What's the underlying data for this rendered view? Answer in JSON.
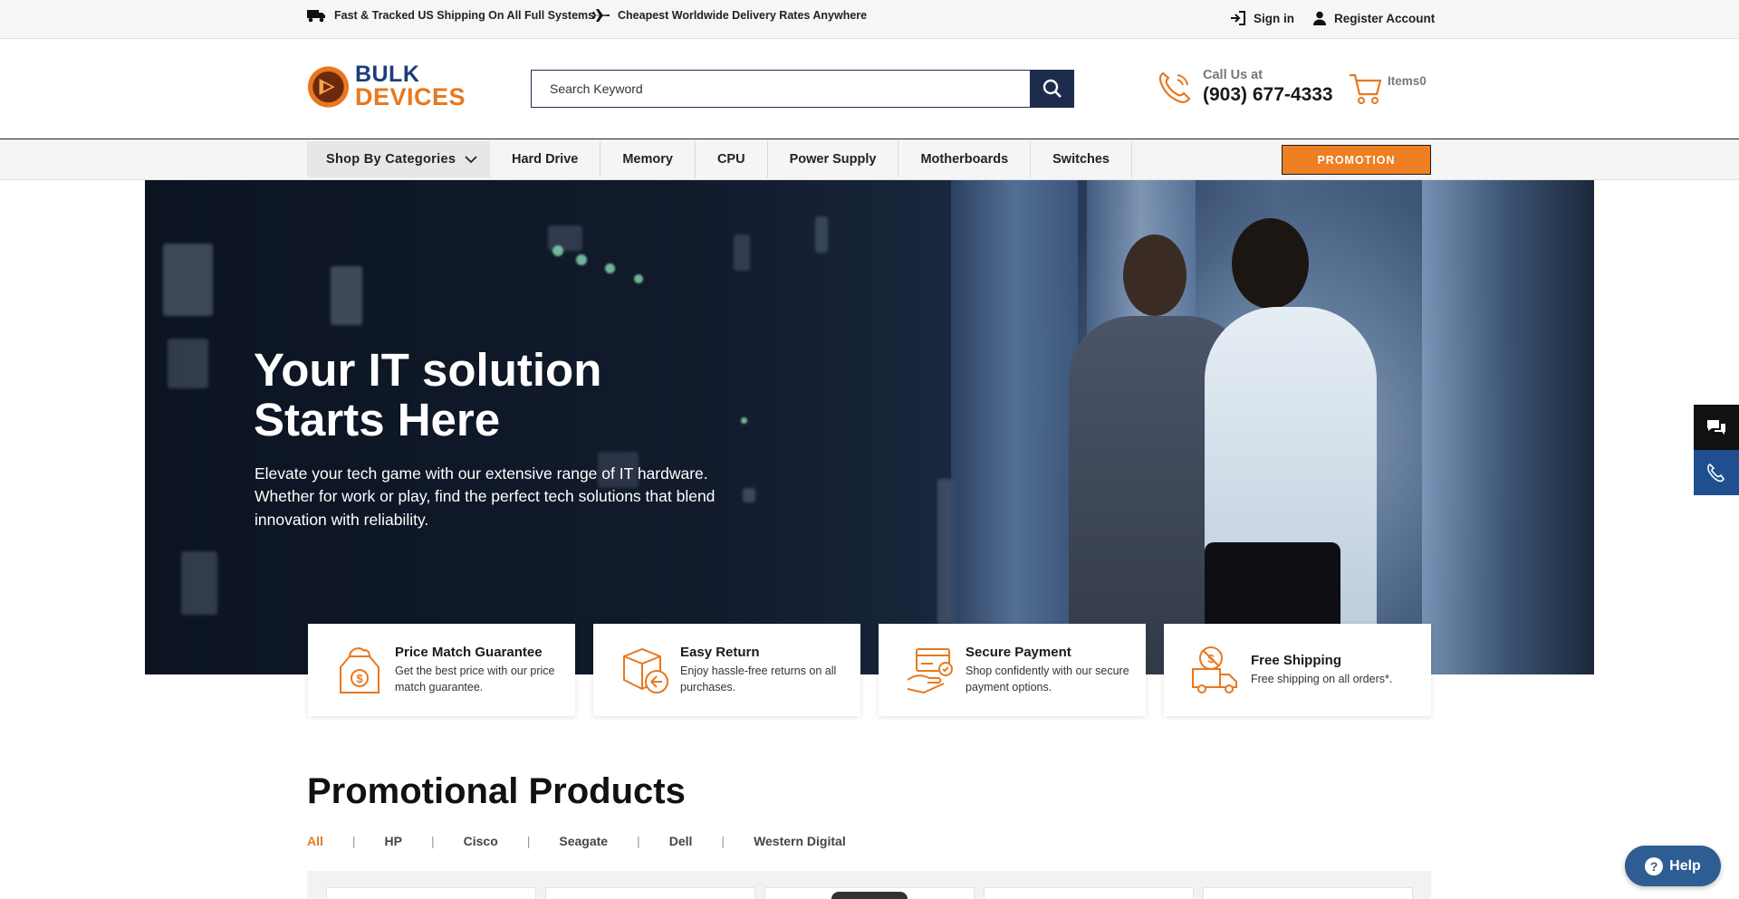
{
  "topbar": {
    "shipping_us": "Fast & Tracked US Shipping On All Full Systems",
    "shipping_world": "Cheapest Worldwide Delivery Rates Anywhere",
    "sign_in": "Sign in",
    "register": "Register Account",
    "icons": [
      "truck-icon",
      "plane-icon",
      "sign-in-icon",
      "user-icon"
    ]
  },
  "header": {
    "logo_line1": "BULK",
    "logo_line2": "DEVICES",
    "search_placeholder": "Search Keyword",
    "call_label": "Call Us at",
    "phone": "(903) 677-4333",
    "cart_label": "Items",
    "cart_count": "0"
  },
  "nav": {
    "categories": "Shop By Categories",
    "links": [
      "Hard Drive",
      "Memory",
      "CPU",
      "Power Supply",
      "Motherboards",
      "Switches"
    ],
    "promotion": "PROMOTION"
  },
  "hero": {
    "headline_1": "Your IT solution",
    "headline_2": "Starts Here",
    "body": "Elevate your tech game with our extensive range of IT hardware. Whether for work or play, find the perfect tech solutions that blend innovation with reliability."
  },
  "features": [
    {
      "title": "Price Match Guarantee",
      "desc": "Get the best price with our price match guarantee.",
      "icon": "price-tag-icon"
    },
    {
      "title": "Easy Return",
      "desc": "Enjoy hassle-free returns on all purchases.",
      "icon": "return-box-icon"
    },
    {
      "title": "Secure Payment",
      "desc": "Shop confidently with our secure payment options.",
      "icon": "secure-card-icon"
    },
    {
      "title": "Free Shipping",
      "desc": "Free shipping on all orders*.",
      "icon": "delivery-truck-icon"
    }
  ],
  "promotional": {
    "title": "Promotional Products",
    "filters": [
      "All",
      "HP",
      "Cisco",
      "Seagate",
      "Dell",
      "Western Digital"
    ],
    "active_filter": "All"
  },
  "help": {
    "label": "Help"
  },
  "colors": {
    "accent": "#ee7f22",
    "navy": "#1d2c4d",
    "help_blue": "#2e5d93",
    "phone_tab": "#1f4f8f"
  }
}
